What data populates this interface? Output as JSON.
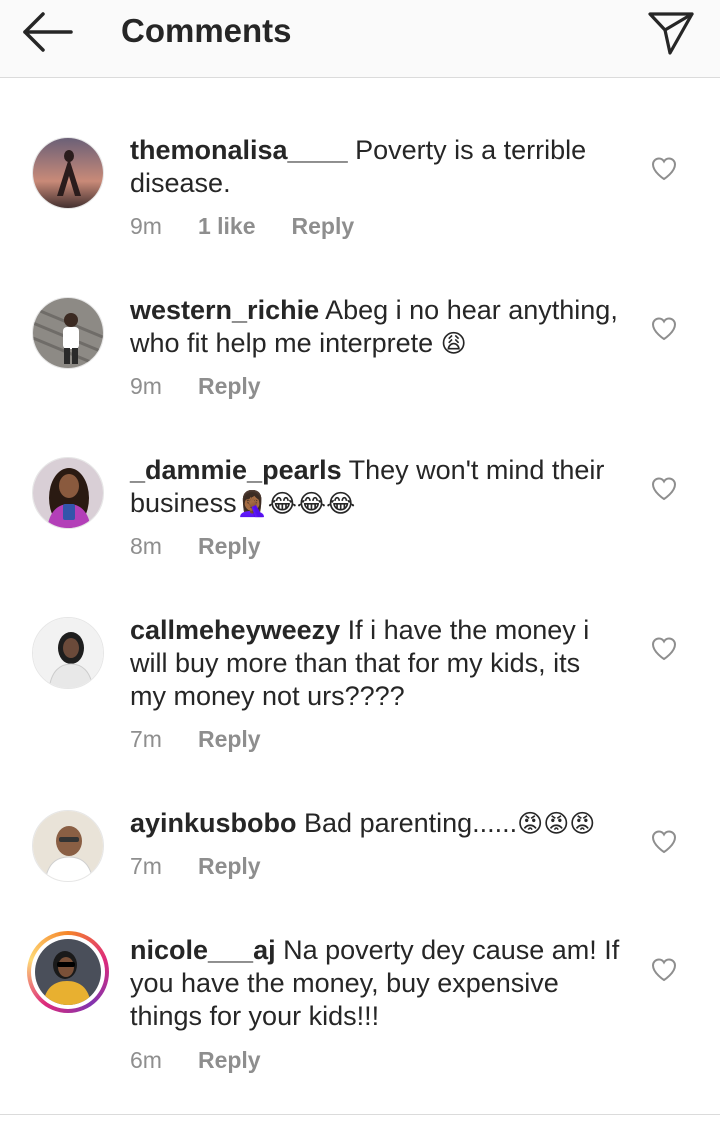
{
  "header": {
    "title": "Comments",
    "back_icon": "arrow-left-icon",
    "send_icon": "paper-plane-icon"
  },
  "comments": [
    {
      "username": "themonalisa____",
      "text": " Poverty is a terrible disease.",
      "time": "9m",
      "likes": "1 like",
      "reply": "Reply"
    },
    {
      "username": "western_richie",
      "text": " Abeg i no hear anything, who fit help me interprete ",
      "emoji": "😩",
      "time": "9m",
      "reply": "Reply"
    },
    {
      "username": "_dammie_pearls",
      "text": " They won't mind their business",
      "emoji": "🤦🏾‍♀️😂😂😂",
      "time": "8m",
      "reply": "Reply"
    },
    {
      "username": "callmeheyweezy",
      "text": " If i have the money i will buy more than that for my kids, its my money not urs????",
      "time": "7m",
      "reply": "Reply"
    },
    {
      "username": "ayinkusbobo",
      "text": " Bad parenting......",
      "emoji": "😡😡😡",
      "time": "7m",
      "reply": "Reply"
    },
    {
      "username": "nicole___aj",
      "text": " Na poverty dey cause am! If you have the money, buy expensive things for your kids!!!",
      "time": "6m",
      "reply": "Reply"
    }
  ],
  "colors": {
    "text": "#262626",
    "meta": "#8e8e8e",
    "header_bg": "#fafafa",
    "divider": "#dbdbdb"
  }
}
